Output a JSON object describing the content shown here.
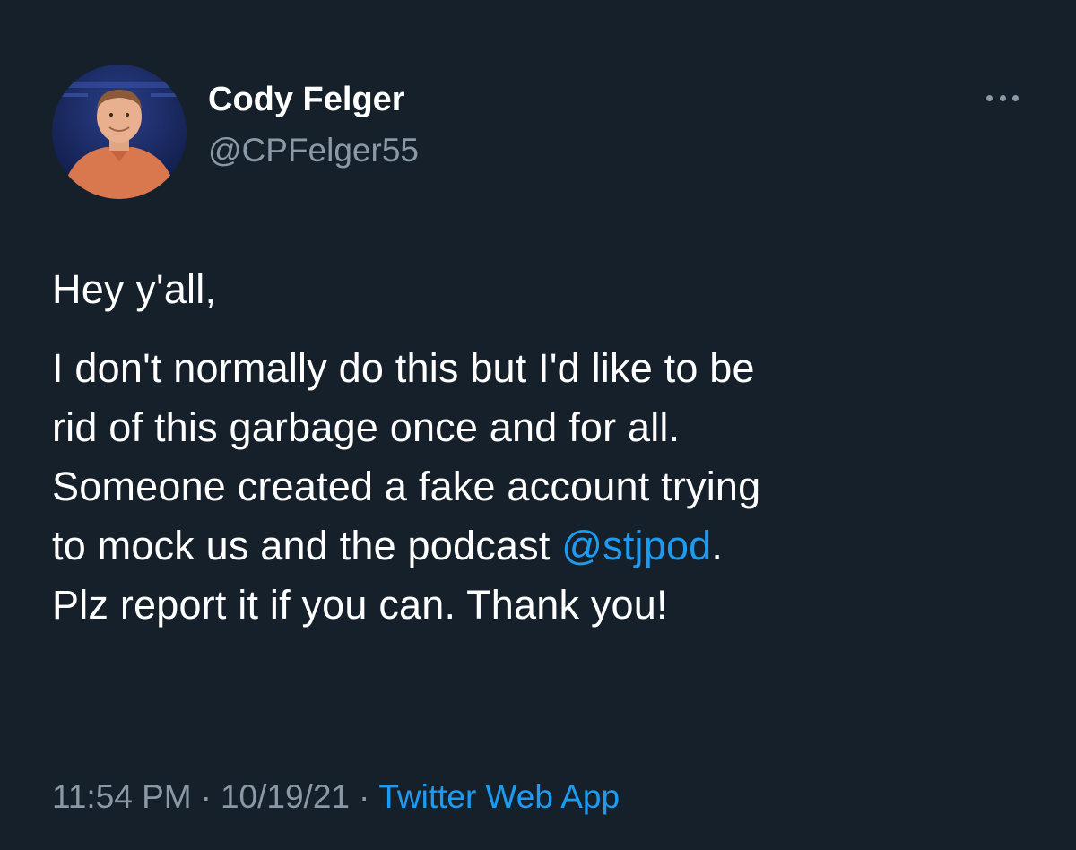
{
  "author": {
    "name": "Cody Felger",
    "handle": "@CPFelger55"
  },
  "tweet": {
    "greeting": "Hey y'all,",
    "lines": [
      "I don't normally do this but I'd like to be",
      "rid of this garbage once and for all.",
      "Someone created a fake account trying"
    ],
    "line4_prefix": "to mock us and the podcast ",
    "mention": "@stjpod",
    "line4_suffix": ".",
    "line5": "Plz report it if you can. Thank you!"
  },
  "meta": {
    "time": "11:54 PM",
    "separator": "·",
    "date": "10/19/21",
    "source": "Twitter Web App"
  },
  "icons": {
    "more": "more-horizontal-icon"
  },
  "colors": {
    "background": "#15202b",
    "text": "#ffffff",
    "secondary": "#8b98a5",
    "link": "#1d9bf0"
  }
}
